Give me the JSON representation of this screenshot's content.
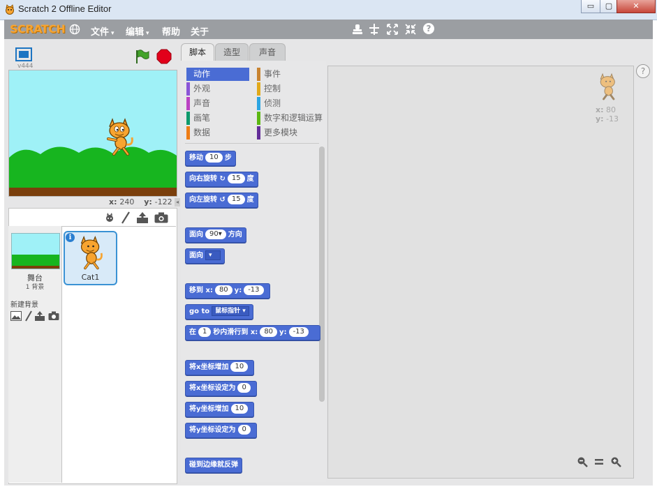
{
  "window": {
    "title": "Scratch 2 Offline Editor",
    "minimize": "▭",
    "maximize": "▢",
    "close": "✕"
  },
  "menubar": {
    "logo": "SCRATCH",
    "items": [
      {
        "label": "文件",
        "caret": "▾"
      },
      {
        "label": "编辑",
        "caret": "▾"
      },
      {
        "label": "帮助",
        "caret": ""
      },
      {
        "label": "关于",
        "caret": ""
      }
    ],
    "tools": [
      "stamp-icon",
      "cut-icon",
      "grow-icon",
      "shrink-icon",
      "help-icon"
    ],
    "help_glyph": "?"
  },
  "stage": {
    "version": "v444",
    "x_label": "x:",
    "x_value": "240",
    "y_label": "y:",
    "y_value": "-122"
  },
  "sprite_panel": {
    "stage_label": "舞台",
    "stage_sub": "1 背景",
    "new_backdrop": "新建背景",
    "sprites": [
      {
        "name": "Cat1"
      }
    ],
    "info_glyph": "i"
  },
  "tabs": [
    {
      "label": "脚本",
      "active": true
    },
    {
      "label": "造型",
      "active": false
    },
    {
      "label": "声音",
      "active": false
    }
  ],
  "categories": [
    {
      "label": "动作",
      "color": "#4a6cd4",
      "selected": true
    },
    {
      "label": "事件",
      "color": "#c88330",
      "selected": false
    },
    {
      "label": "外观",
      "color": "#8a55d7",
      "selected": false
    },
    {
      "label": "控制",
      "color": "#e1a91a",
      "selected": false
    },
    {
      "label": "声音",
      "color": "#bb42c3",
      "selected": false
    },
    {
      "label": "侦测",
      "color": "#2ca5e2",
      "selected": false
    },
    {
      "label": "画笔",
      "color": "#0e9a6c",
      "selected": false
    },
    {
      "label": "数字和逻辑运算",
      "color": "#5cb712",
      "selected": false
    },
    {
      "label": "数据",
      "color": "#ee7d16",
      "selected": false
    },
    {
      "label": "更多模块",
      "color": "#632d99",
      "selected": false
    }
  ],
  "blocks": {
    "move": {
      "pre": "移动",
      "val": "10",
      "post": "步"
    },
    "turn_right": {
      "pre": "向右旋转",
      "icon": "↻",
      "val": "15",
      "post": "度"
    },
    "turn_left": {
      "pre": "向左旋转",
      "icon": "↺",
      "val": "15",
      "post": "度"
    },
    "point_dir": {
      "pre": "面向",
      "val": "90▾",
      "post": "方向"
    },
    "point_towards": {
      "pre": "面向",
      "dd": "▾"
    },
    "goto_xy": {
      "pre": "移到",
      "xl": "x:",
      "xv": "80",
      "yl": "y:",
      "yv": "-13"
    },
    "goto": {
      "pre": "go",
      "mid": "to",
      "dd": "鼠标指针 ▾"
    },
    "glide": {
      "pre": "在",
      "sv": "1",
      "mid": "秒内滑行到",
      "xl": "x:",
      "xv": "80",
      "yl": "y:",
      "yv": "-13"
    },
    "change_x": {
      "pre": "将x坐标增加",
      "val": "10"
    },
    "set_x": {
      "pre": "将x坐标设定为",
      "val": "0"
    },
    "change_y": {
      "pre": "将y坐标增加",
      "val": "10"
    },
    "set_y": {
      "pre": "将y坐标设定为",
      "val": "0"
    },
    "bounce": {
      "pre": "碰到边缘就反弹"
    }
  },
  "script_area": {
    "sprite_x_label": "x:",
    "sprite_x": "80",
    "sprite_y_label": "y:",
    "sprite_y": "-13"
  },
  "colors": {
    "motion": "#4a6cd4",
    "menubar": "#9b9ea2",
    "stage_sky": "#9ff1f7",
    "grass": "#17b51f",
    "ground": "#7a3f0c"
  }
}
